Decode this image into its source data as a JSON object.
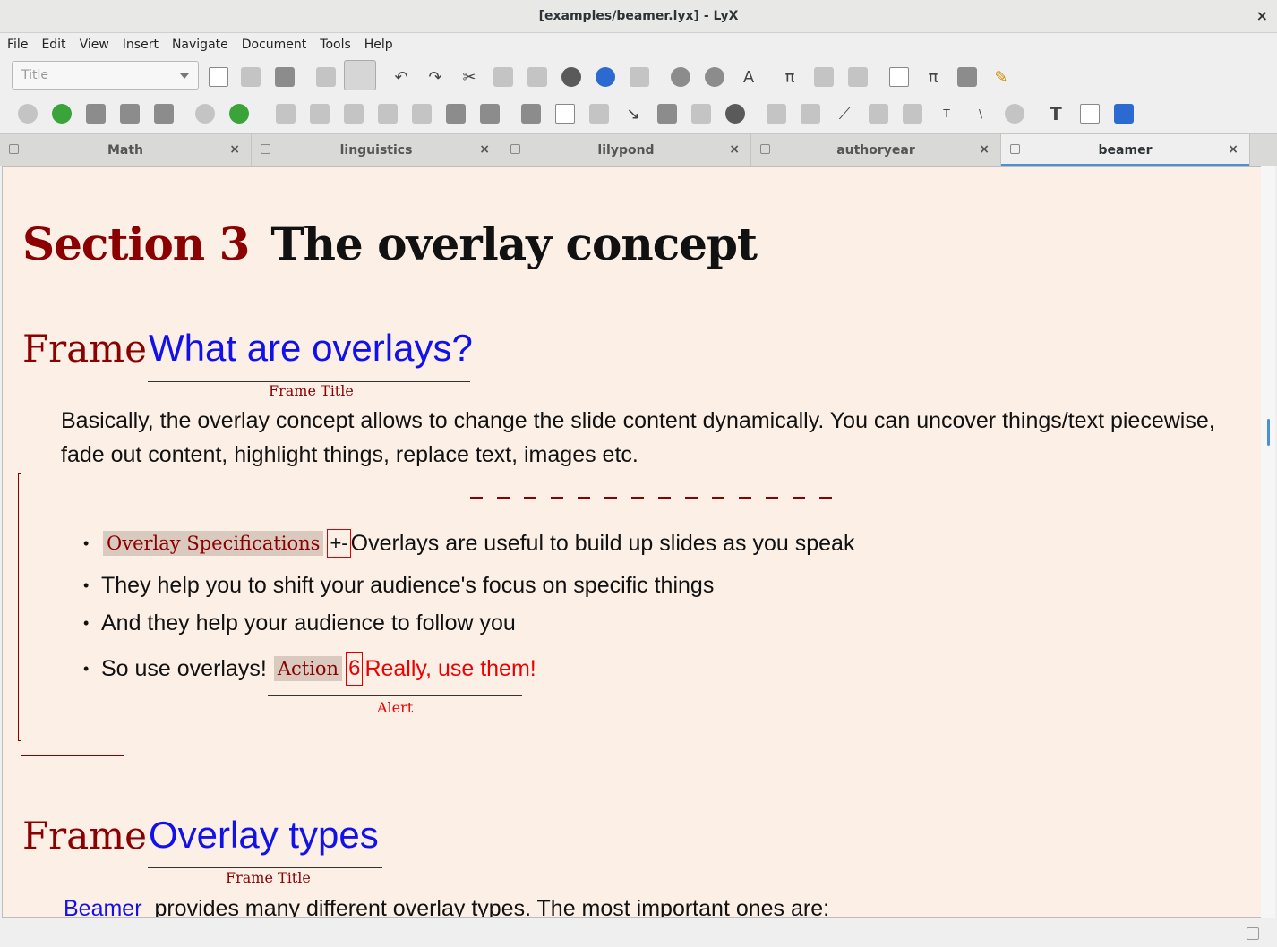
{
  "window": {
    "title": "[examples/beamer.lyx] - LyX",
    "close_glyph": "×"
  },
  "menubar": {
    "items": [
      "File",
      "Edit",
      "View",
      "Insert",
      "Navigate",
      "Document",
      "Tools",
      "Help"
    ]
  },
  "toolbar": {
    "layout_select_value": "Title",
    "layout_icons": [
      "new-document-icon",
      "open-folder-icon",
      "save-icon",
      "spellcheck-icon",
      "spellcheck-continuous-icon",
      "undo-icon",
      "redo-icon",
      "cut-icon",
      "copy-icon",
      "paste-icon",
      "find-icon",
      "find-replace-icon",
      "change-tracking-icon",
      "note-icon",
      "info-icon",
      "text-style-icon",
      "math-pi-icon",
      "insert-graphics-icon",
      "insert-table-icon",
      "toc-icon",
      "math-mode-icon",
      "table-icon",
      "pencil-icon"
    ],
    "second_row_icons": [
      "view-icon",
      "update-icon",
      "view-other-icon",
      "view-other2-icon",
      "export-icon",
      "view-master-icon",
      "update-master-icon",
      "align-left-icon",
      "enumerate-icon",
      "itemize-icon",
      "align-right-icon",
      "outdent-icon",
      "indent-icon",
      "list-icon",
      "insert-image-icon",
      "insert-table2-icon",
      "label-icon",
      "cross-ref-icon",
      "footnote-icon",
      "marginal-note-icon",
      "citation-icon",
      "bibtex-icon",
      "index-icon",
      "edit-icon",
      "edit2-icon",
      "clear-icon",
      "tex-icon",
      "foo-icon",
      "attachment-icon",
      "text-icon",
      "textbox-icon",
      "abc-icon"
    ]
  },
  "tabs": [
    {
      "label": "Math",
      "active": false
    },
    {
      "label": "linguistics",
      "active": false
    },
    {
      "label": "lilypond",
      "active": false
    },
    {
      "label": "authoryear",
      "active": false
    },
    {
      "label": "beamer",
      "active": true
    }
  ],
  "document": {
    "section_label": "Section 3",
    "section_title": "The overlay concept",
    "frames": [
      {
        "label": "Frame",
        "title": "What are overlays?",
        "inset_label": "Frame Title"
      },
      {
        "label": "Frame",
        "title": "Overlay types",
        "inset_label": "Frame Title"
      }
    ],
    "intro_paragraph": "Basically, the overlay concept allows to change the slide content dynamically. You can uncover things/text piecewise, fade out content, highlight things, replace text, images etc.",
    "bullets": [
      {
        "overlay_label": "Overlay Specifications",
        "spec": "+-",
        "text": "Overlays are useful to build up slides as you speak"
      },
      {
        "text": "They help you to shift your audience's focus on specific things"
      },
      {
        "text": "And they help your audience to follow you"
      },
      {
        "text": "So use overlays!",
        "action_label": "Action",
        "action_num": "6",
        "alert_text": "Really, use them!",
        "alert_inset_label": "Alert"
      }
    ],
    "last_line_link": "Beamer",
    "last_line_text": "provides many different overlay types. The most important ones are:"
  },
  "colors": {
    "canvas": "#fbefe6",
    "label_dark_red": "#8b0000",
    "frame_title_blue": "#1212e8",
    "alert_red": "#e00000",
    "tab_active_underline": "#4a90d9"
  }
}
